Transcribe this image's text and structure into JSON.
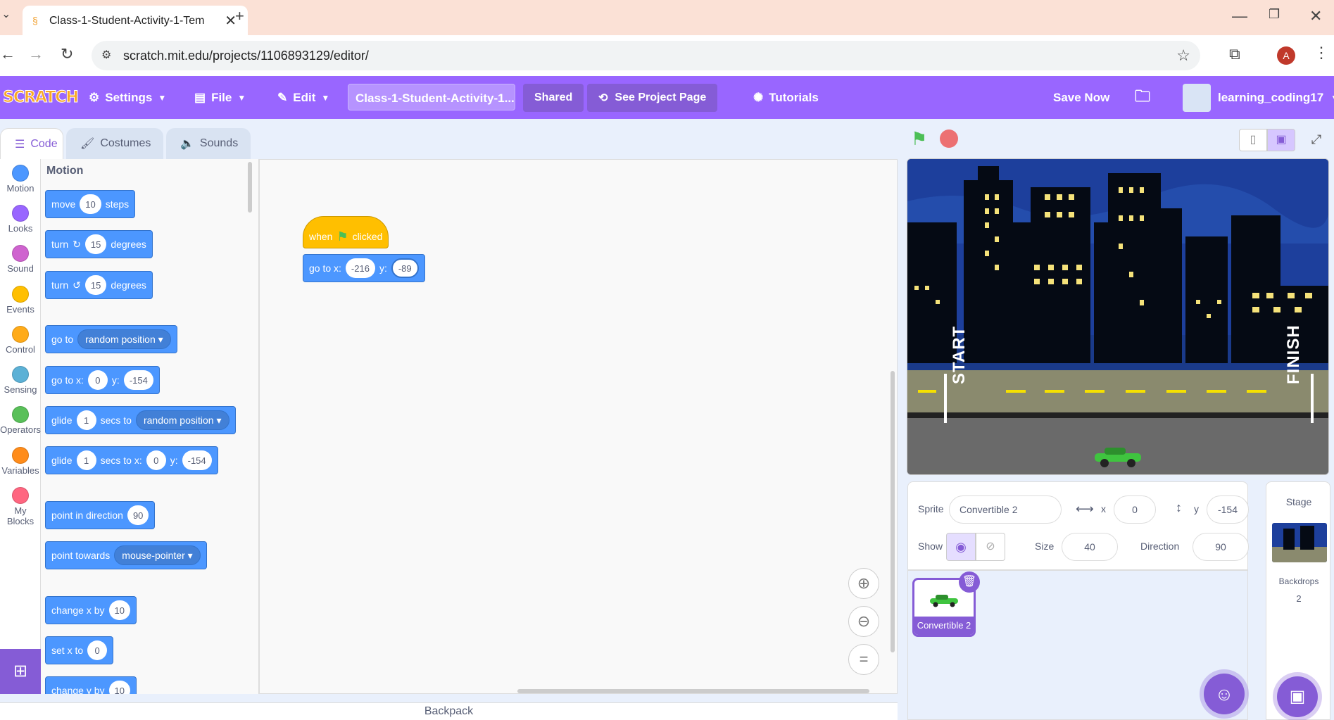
{
  "browser": {
    "tab_title": "Class-1-Student-Activity-1-Tem",
    "url": "scratch.mit.edu/projects/1106893129/editor/",
    "profile_initial": "A"
  },
  "menu": {
    "logo": "SCRATCH",
    "settings": "Settings",
    "file": "File",
    "edit": "Edit",
    "project_title": "Class-1-Student-Activity-1...",
    "shared": "Shared",
    "see_project_page": "See Project Page",
    "tutorials": "Tutorials",
    "save_now": "Save Now",
    "username": "learning_coding17"
  },
  "editor_tabs": {
    "code": "Code",
    "costumes": "Costumes",
    "sounds": "Sounds"
  },
  "categories": [
    {
      "label": "Motion",
      "color": "#4c97ff"
    },
    {
      "label": "Looks",
      "color": "#9966ff"
    },
    {
      "label": "Sound",
      "color": "#cf63cf"
    },
    {
      "label": "Events",
      "color": "#ffbf00"
    },
    {
      "label": "Control",
      "color": "#ffab19"
    },
    {
      "label": "Sensing",
      "color": "#5cb1d6"
    },
    {
      "label": "Operators",
      "color": "#59c059"
    },
    {
      "label": "Variables",
      "color": "#ff8c1a"
    },
    {
      "label": "My Blocks",
      "color": "#ff6680"
    }
  ],
  "palette": {
    "heading": "Motion",
    "move": {
      "a": "move",
      "v": "10",
      "b": "steps"
    },
    "turn_right": {
      "a": "turn",
      "v": "15",
      "b": "degrees"
    },
    "turn_left": {
      "a": "turn",
      "v": "15",
      "b": "degrees"
    },
    "go_to": {
      "a": "go to",
      "opt": "random position"
    },
    "go_to_xy": {
      "a": "go to x:",
      "x": "0",
      "b": "y:",
      "y": "-154"
    },
    "glide_to": {
      "a": "glide",
      "v": "1",
      "b": "secs to",
      "opt": "random position"
    },
    "glide_xy": {
      "a": "glide",
      "v": "1",
      "b": "secs to x:",
      "x": "0",
      "c": "y:",
      "y": "-154"
    },
    "point_dir": {
      "a": "point in direction",
      "v": "90"
    },
    "point_towards": {
      "a": "point towards",
      "opt": "mouse-pointer"
    },
    "change_x": {
      "a": "change x by",
      "v": "10"
    },
    "set_x": {
      "a": "set x to",
      "v": "0"
    },
    "change_y": {
      "a": "change y by",
      "v": "10"
    }
  },
  "script": {
    "hat_a": "when",
    "hat_b": "clicked",
    "goto_a": "go to x:",
    "goto_x": "-216",
    "goto_b": "y:",
    "goto_y": "-89"
  },
  "backpack": "Backpack",
  "stage": {
    "start": "START",
    "finish": "FINISH"
  },
  "sprite_info": {
    "sprite_label": "Sprite",
    "sprite_name": "Convertible 2",
    "x_label": "x",
    "x": "0",
    "y_label": "y",
    "y": "-154",
    "show_label": "Show",
    "size_label": "Size",
    "size": "40",
    "direction_label": "Direction",
    "direction": "90"
  },
  "sprites": [
    {
      "name": "Convertible 2"
    }
  ],
  "stage_panel": {
    "title": "Stage",
    "backdrops_label": "Backdrops",
    "backdrops_count": "2"
  }
}
